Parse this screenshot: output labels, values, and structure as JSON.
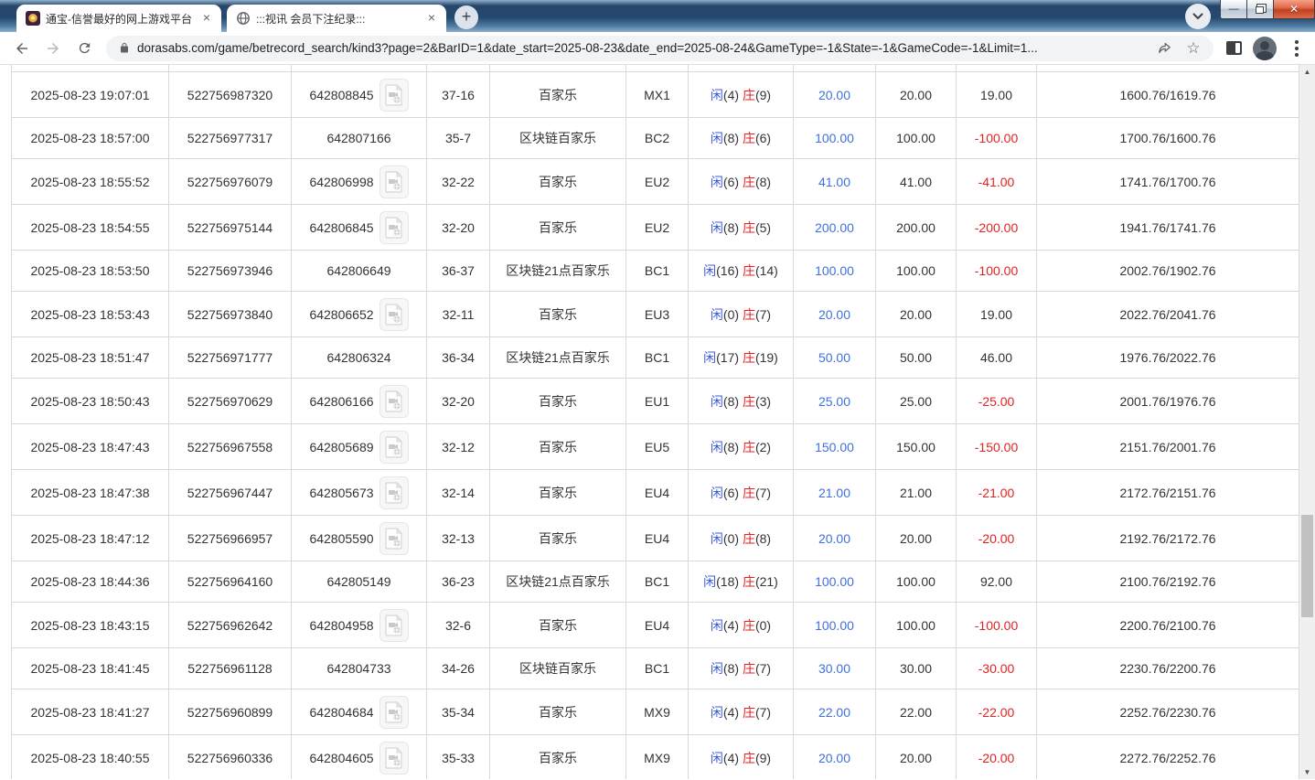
{
  "browser": {
    "tabs": [
      {
        "title": "通宝-信誉最好的网上游戏平台",
        "close_label": "×"
      },
      {
        "title": ":::视讯 会员下注纪录:::",
        "close_label": "×"
      }
    ],
    "newtab_label": "+",
    "url": "dorasabs.com/game/betrecord_search/kind3?page=2&BarID=1&date_start=2025-08-23&date_end=2025-08-24&GameType=-1&State=-1&GameCode=-1&Limit=1...",
    "window_controls": {
      "minimize": "—",
      "close": "✕"
    }
  },
  "colors": {
    "player_blue": "#3c5bd9",
    "banker_red": "#e32222",
    "bet_amount_blue": "#3f6fe0",
    "negative_red": "#e32222",
    "text_dark": "#333333",
    "row_border": "#d8d8d8"
  },
  "labels": {
    "player": "闲",
    "banker": "庄"
  },
  "scrollbar": {
    "up_glyph": "▲",
    "down_glyph": "▼"
  },
  "table": {
    "rows": [
      {
        "time": "2025-08-23 19:07:01",
        "bet_id": "522756987320",
        "game_no": "642808845",
        "video": true,
        "result": "37-16",
        "game_name": "百家乐",
        "table_code": "MX1",
        "player_count": "(4)",
        "banker_count": "(9)",
        "bet": "20.00",
        "valid": "20.00",
        "winloss": "19.00",
        "balance": "1600.76/1619.76"
      },
      {
        "time": "2025-08-23 18:57:00",
        "bet_id": "522756977317",
        "game_no": "642807166",
        "video": false,
        "result": "35-7",
        "game_name": "区块链百家乐",
        "table_code": "BC2",
        "player_count": "(8)",
        "banker_count": "(6)",
        "bet": "100.00",
        "valid": "100.00",
        "winloss": "-100.00",
        "balance": "1700.76/1600.76"
      },
      {
        "time": "2025-08-23 18:55:52",
        "bet_id": "522756976079",
        "game_no": "642806998",
        "video": true,
        "result": "32-22",
        "game_name": "百家乐",
        "table_code": "EU2",
        "player_count": "(6)",
        "banker_count": "(8)",
        "bet": "41.00",
        "valid": "41.00",
        "winloss": "-41.00",
        "balance": "1741.76/1700.76"
      },
      {
        "time": "2025-08-23 18:54:55",
        "bet_id": "522756975144",
        "game_no": "642806845",
        "video": true,
        "result": "32-20",
        "game_name": "百家乐",
        "table_code": "EU2",
        "player_count": "(8)",
        "banker_count": "(5)",
        "bet": "200.00",
        "valid": "200.00",
        "winloss": "-200.00",
        "balance": "1941.76/1741.76"
      },
      {
        "time": "2025-08-23 18:53:50",
        "bet_id": "522756973946",
        "game_no": "642806649",
        "video": false,
        "result": "36-37",
        "game_name": "区块链21点百家乐",
        "table_code": "BC1",
        "player_count": "(16)",
        "banker_count": "(14)",
        "bet": "100.00",
        "valid": "100.00",
        "winloss": "-100.00",
        "balance": "2002.76/1902.76"
      },
      {
        "time": "2025-08-23 18:53:43",
        "bet_id": "522756973840",
        "game_no": "642806652",
        "video": true,
        "result": "32-11",
        "game_name": "百家乐",
        "table_code": "EU3",
        "player_count": "(0)",
        "banker_count": "(7)",
        "bet": "20.00",
        "valid": "20.00",
        "winloss": "19.00",
        "balance": "2022.76/2041.76"
      },
      {
        "time": "2025-08-23 18:51:47",
        "bet_id": "522756971777",
        "game_no": "642806324",
        "video": false,
        "result": "36-34",
        "game_name": "区块链21点百家乐",
        "table_code": "BC1",
        "player_count": "(17)",
        "banker_count": "(19)",
        "bet": "50.00",
        "valid": "50.00",
        "winloss": "46.00",
        "balance": "1976.76/2022.76"
      },
      {
        "time": "2025-08-23 18:50:43",
        "bet_id": "522756970629",
        "game_no": "642806166",
        "video": true,
        "result": "32-20",
        "game_name": "百家乐",
        "table_code": "EU1",
        "player_count": "(8)",
        "banker_count": "(3)",
        "bet": "25.00",
        "valid": "25.00",
        "winloss": "-25.00",
        "balance": "2001.76/1976.76"
      },
      {
        "time": "2025-08-23 18:47:43",
        "bet_id": "522756967558",
        "game_no": "642805689",
        "video": true,
        "result": "32-12",
        "game_name": "百家乐",
        "table_code": "EU5",
        "player_count": "(8)",
        "banker_count": "(2)",
        "bet": "150.00",
        "valid": "150.00",
        "winloss": "-150.00",
        "balance": "2151.76/2001.76"
      },
      {
        "time": "2025-08-23 18:47:38",
        "bet_id": "522756967447",
        "game_no": "642805673",
        "video": true,
        "result": "32-14",
        "game_name": "百家乐",
        "table_code": "EU4",
        "player_count": "(6)",
        "banker_count": "(7)",
        "bet": "21.00",
        "valid": "21.00",
        "winloss": "-21.00",
        "balance": "2172.76/2151.76"
      },
      {
        "time": "2025-08-23 18:47:12",
        "bet_id": "522756966957",
        "game_no": "642805590",
        "video": true,
        "result": "32-13",
        "game_name": "百家乐",
        "table_code": "EU4",
        "player_count": "(0)",
        "banker_count": "(8)",
        "bet": "20.00",
        "valid": "20.00",
        "winloss": "-20.00",
        "balance": "2192.76/2172.76"
      },
      {
        "time": "2025-08-23 18:44:36",
        "bet_id": "522756964160",
        "game_no": "642805149",
        "video": false,
        "result": "36-23",
        "game_name": "区块链21点百家乐",
        "table_code": "BC1",
        "player_count": "(18)",
        "banker_count": "(21)",
        "bet": "100.00",
        "valid": "100.00",
        "winloss": "92.00",
        "balance": "2100.76/2192.76"
      },
      {
        "time": "2025-08-23 18:43:15",
        "bet_id": "522756962642",
        "game_no": "642804958",
        "video": true,
        "result": "32-6",
        "game_name": "百家乐",
        "table_code": "EU4",
        "player_count": "(4)",
        "banker_count": "(0)",
        "bet": "100.00",
        "valid": "100.00",
        "winloss": "-100.00",
        "balance": "2200.76/2100.76"
      },
      {
        "time": "2025-08-23 18:41:45",
        "bet_id": "522756961128",
        "game_no": "642804733",
        "video": false,
        "result": "34-26",
        "game_name": "区块链百家乐",
        "table_code": "BC1",
        "player_count": "(8)",
        "banker_count": "(7)",
        "bet": "30.00",
        "valid": "30.00",
        "winloss": "-30.00",
        "balance": "2230.76/2200.76"
      },
      {
        "time": "2025-08-23 18:41:27",
        "bet_id": "522756960899",
        "game_no": "642804684",
        "video": true,
        "result": "35-34",
        "game_name": "百家乐",
        "table_code": "MX9",
        "player_count": "(4)",
        "banker_count": "(7)",
        "bet": "22.00",
        "valid": "22.00",
        "winloss": "-22.00",
        "balance": "2252.76/2230.76"
      },
      {
        "time": "2025-08-23 18:40:55",
        "bet_id": "522756960336",
        "game_no": "642804605",
        "video": true,
        "result": "35-33",
        "game_name": "百家乐",
        "table_code": "MX9",
        "player_count": "(4)",
        "banker_count": "(9)",
        "bet": "20.00",
        "valid": "20.00",
        "winloss": "-20.00",
        "balance": "2272.76/2252.76"
      }
    ]
  }
}
